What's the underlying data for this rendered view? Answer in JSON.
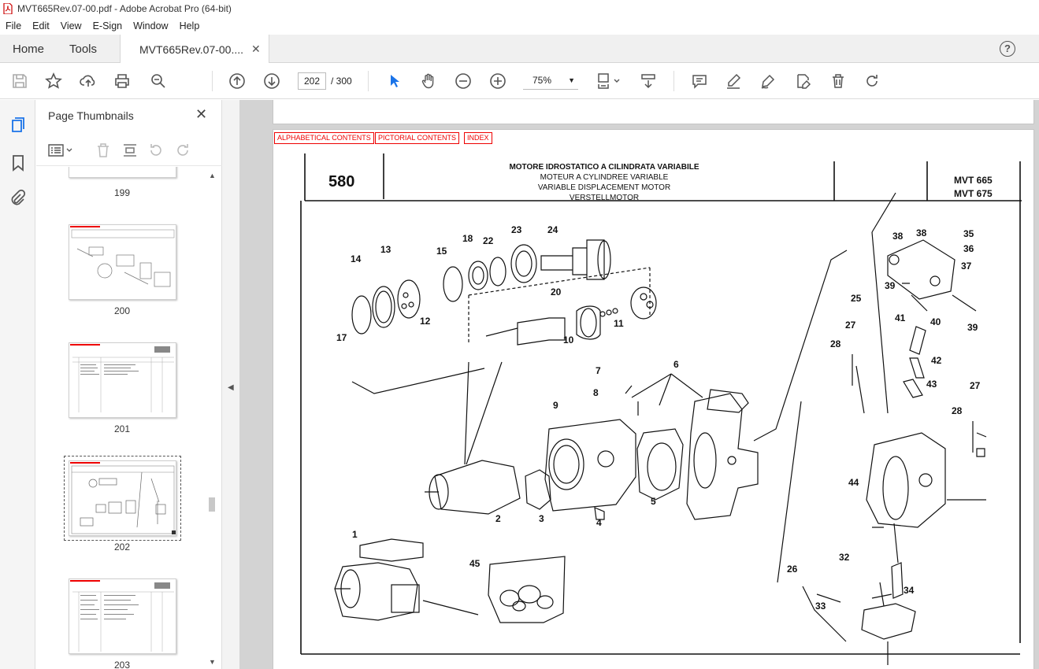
{
  "window": {
    "title": "MVT665Rev.07-00.pdf - Adobe Acrobat Pro (64-bit)"
  },
  "menu": [
    "File",
    "Edit",
    "View",
    "E-Sign",
    "Window",
    "Help"
  ],
  "tabs": {
    "home": "Home",
    "tools": "Tools",
    "document": "MVT665Rev.07-00...."
  },
  "toolbar": {
    "current_page": "202",
    "total_pages": "/ 300",
    "zoom": "75%"
  },
  "panel": {
    "title": "Page Thumbnails",
    "thumbnails": [
      {
        "label": "199"
      },
      {
        "label": "200"
      },
      {
        "label": "201"
      },
      {
        "label": "202",
        "selected": true
      },
      {
        "label": "203"
      }
    ]
  },
  "document": {
    "nav_links": [
      "ALPHABETICAL CONTENTS",
      "PICTORIAL CONTENTS",
      "INDEX"
    ],
    "plate_number": "580",
    "title_lines": [
      "MOTORE IDROSTATICO A CILINDRATA VARIABILE",
      "MOTEUR A CYLINDREE VARIABLE",
      "VARIABLE DISPLACEMENT MOTOR",
      "VERSTELLMOTOR"
    ],
    "models": [
      "MVT 665",
      "MVT 675"
    ],
    "callouts": [
      "14",
      "13",
      "15",
      "18",
      "22",
      "23",
      "24",
      "17",
      "12",
      "20",
      "11",
      "10",
      "7",
      "6",
      "8",
      "9",
      "2",
      "3",
      "4",
      "5",
      "1",
      "45",
      "38",
      "38",
      "35",
      "36",
      "37",
      "39",
      "40",
      "39",
      "25",
      "41",
      "27",
      "28",
      "42",
      "43",
      "27",
      "28",
      "44",
      "26",
      "32",
      "34",
      "33"
    ]
  },
  "colors": {
    "accent": "#e00000",
    "link_border": "#e00000"
  }
}
